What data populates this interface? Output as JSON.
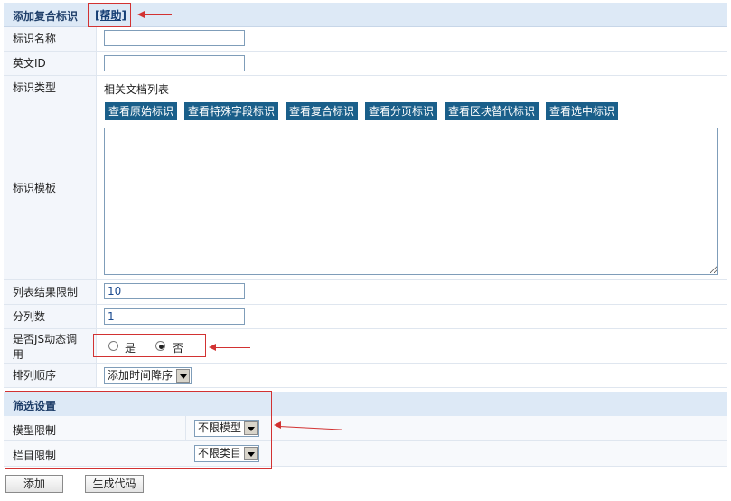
{
  "header": {
    "title": "添加复合标识",
    "help_link": "[帮助]"
  },
  "form": {
    "name_label": "标识名称",
    "name_value": "",
    "en_id_label": "英文ID",
    "en_id_value": "",
    "type_label": "标识类型",
    "type_value": "相关文档列表",
    "template_label": "标识模板",
    "template_buttons": [
      "查看原始标识",
      "查看特殊字段标识",
      "查看复合标识",
      "查看分页标识",
      "查看区块替代标识",
      "查看选中标识"
    ],
    "template_value": "",
    "limit_label": "列表结果限制",
    "limit_value": "10",
    "columns_label": "分列数",
    "columns_value": "1",
    "js_label_line1": "是否JS动态调",
    "js_label_line2": "用",
    "js_options": [
      "是",
      "否"
    ],
    "js_selected": "否",
    "order_label": "排列顺序",
    "order_value": "添加时间降序"
  },
  "filter": {
    "title": "筛选设置",
    "model_label": "模型限制",
    "model_value": "不限模型",
    "category_label": "栏目限制",
    "category_value": "不限类目"
  },
  "actions": {
    "add_label": "添加",
    "generate_label": "生成代码"
  },
  "colors": {
    "accent": "#1a5f8a",
    "header_bg": "#dde9f6",
    "label_bg": "#f3f6fb",
    "annotation": "#d23232"
  }
}
